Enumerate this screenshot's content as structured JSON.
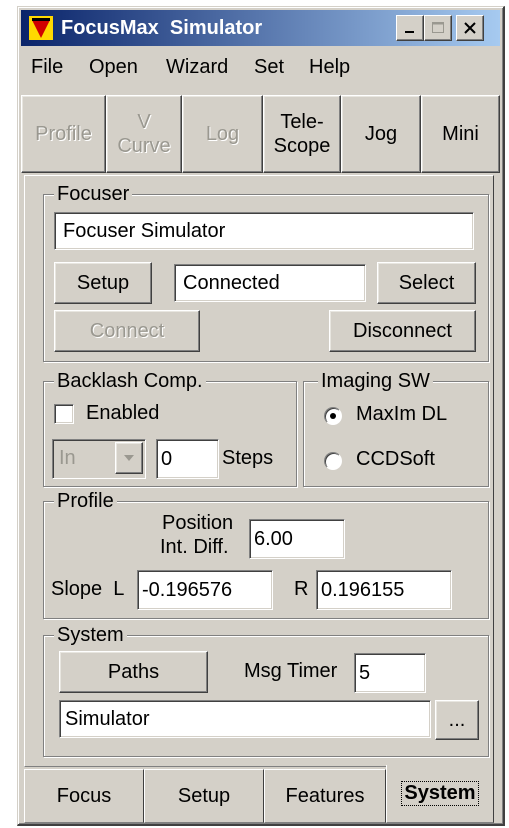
{
  "window": {
    "title": "FocusMax  Simulator"
  },
  "menu": {
    "items": [
      "File",
      "Open",
      "Wizard",
      "Set",
      "Help"
    ]
  },
  "toolbar": {
    "profile": "Profile",
    "vcurve_line1": "V",
    "vcurve_line2": "Curve",
    "log": "Log",
    "telescope_line1": "Tele-",
    "telescope_line2": "Scope",
    "jog": "Jog",
    "mini": "Mini"
  },
  "focuser": {
    "group_label": "Focuser",
    "name": "Focuser Simulator",
    "setup_label": "Setup",
    "status": "Connected",
    "select_label": "Select",
    "connect_label": "Connect",
    "disconnect_label": "Disconnect"
  },
  "backlash": {
    "group_label": "Backlash Comp.",
    "enabled_label": "Enabled",
    "enabled": false,
    "direction": "In",
    "steps_value": "0",
    "steps_label": "Steps"
  },
  "imaging": {
    "group_label": "Imaging SW",
    "options": [
      "MaxIm DL",
      "CCDSoft"
    ],
    "selected": "MaxIm DL"
  },
  "profile": {
    "group_label": "Profile",
    "position_label_line1": "Position",
    "position_label_line2": "Int. Diff.",
    "position_value": "6.00",
    "slope_label": "Slope  L",
    "slope_l": "-0.196576",
    "r_label": "R",
    "slope_r": "0.196155"
  },
  "system": {
    "group_label": "System",
    "paths_label": "Paths",
    "msg_timer_label": "Msg Timer",
    "msg_timer_value": "5",
    "path_value": "Simulator",
    "browse_label": "..."
  },
  "tabs": [
    "Focus",
    "Setup",
    "Features",
    "System"
  ],
  "active_tab": "System",
  "colors": {
    "titlebar_start": "#0a246a",
    "titlebar_end": "#a6caf0",
    "face": "#d4d0c8"
  }
}
